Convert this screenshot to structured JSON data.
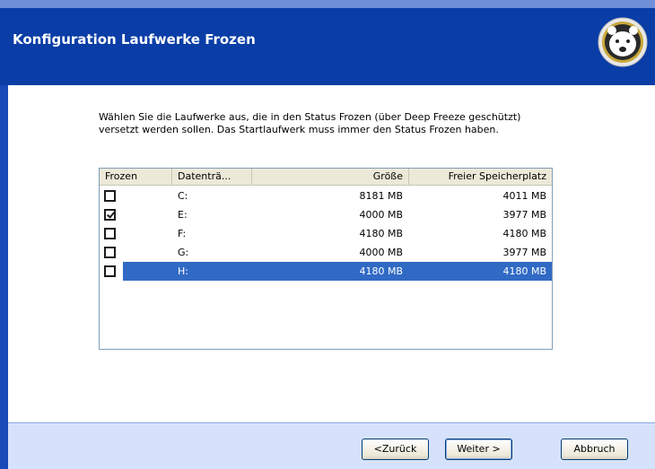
{
  "window": {
    "title": "Konfiguration Laufwerke Frozen"
  },
  "instruction": "Wählen Sie die Laufwerke aus, die in den Status Frozen (über Deep Freeze geschützt) versetzt werden sollen. Das Startlaufwerk muss immer den Status Frozen haben.",
  "table": {
    "columns": [
      "Frozen",
      "Datenträ...",
      "Größe",
      "Freier Speicherplatz"
    ],
    "rows": [
      {
        "checked": false,
        "drive": "C:",
        "size": "8181 MB",
        "free": "4011 MB",
        "selected": false
      },
      {
        "checked": true,
        "drive": "E:",
        "size": "4000 MB",
        "free": "3977 MB",
        "selected": false
      },
      {
        "checked": false,
        "drive": "F:",
        "size": "4180 MB",
        "free": "4180 MB",
        "selected": false
      },
      {
        "checked": false,
        "drive": "G:",
        "size": "4000 MB",
        "free": "3977 MB",
        "selected": false
      },
      {
        "checked": false,
        "drive": "H:",
        "size": "4180 MB",
        "free": "4180 MB",
        "selected": true
      }
    ]
  },
  "buttons": {
    "back": "<Zurück",
    "next": "Weiter >",
    "cancel": "Abbruch"
  },
  "colors": {
    "titlebar": "#0a3da6",
    "selection": "#316ac5",
    "footer": "#d6e2fb"
  },
  "icons": {
    "logo": "polar-bear-logo-icon"
  }
}
